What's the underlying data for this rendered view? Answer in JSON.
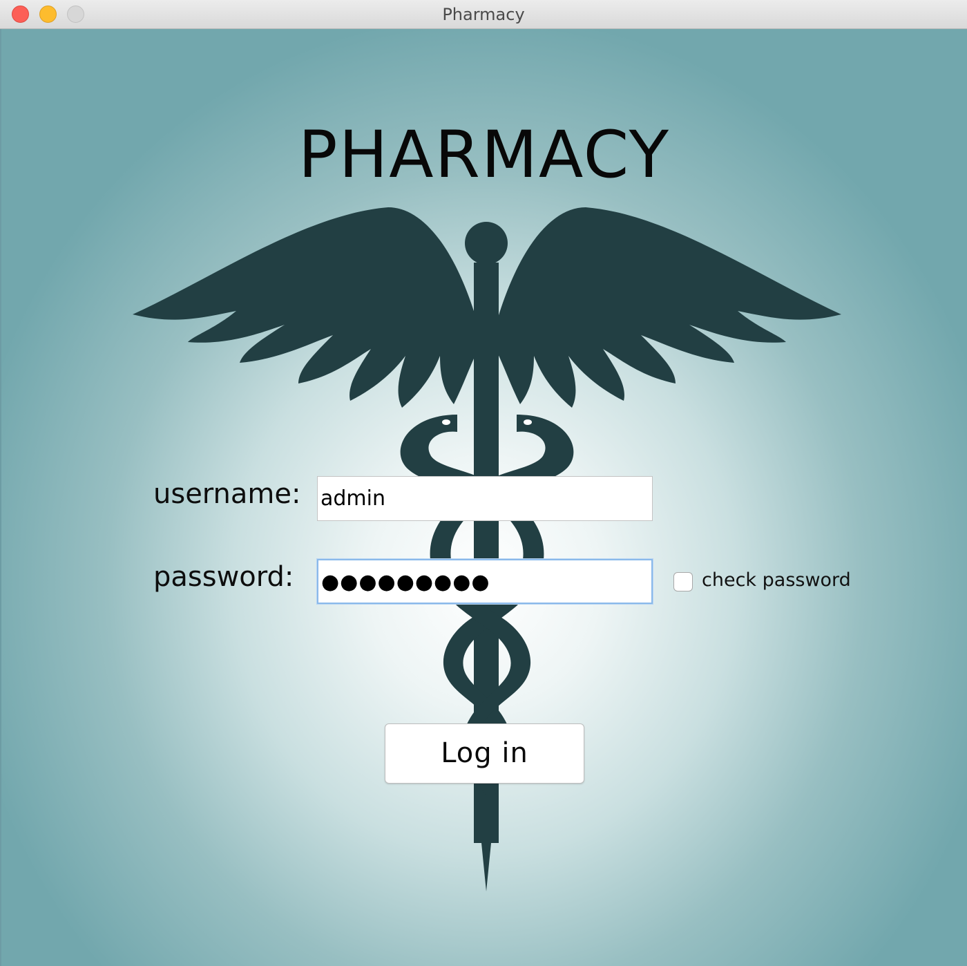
{
  "window": {
    "title": "Pharmacy"
  },
  "login": {
    "heading": "PHARMACY",
    "username_label": "username:",
    "username_value": "admin",
    "password_label": "password:",
    "password_masked": "●●●●●●●●●",
    "check_password_label": "check password",
    "check_password_checked": false,
    "login_button_label": "Log in"
  },
  "icons": {
    "emblem": "caduceus-icon"
  },
  "colors": {
    "background_edge": "#72a7ad",
    "background_center": "#ffffff",
    "emblem": "#223f43",
    "focus_ring": "#8ab9ea"
  }
}
